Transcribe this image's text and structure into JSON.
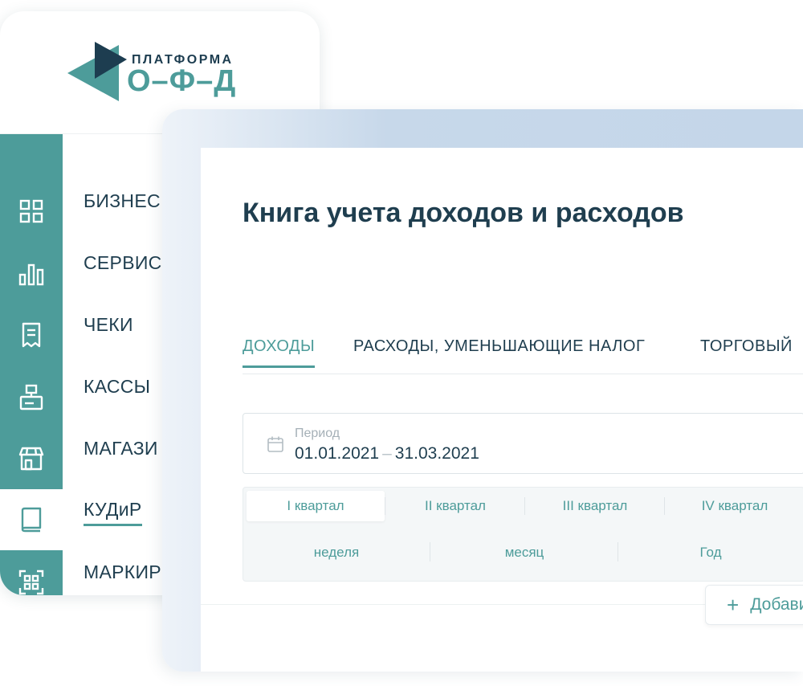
{
  "logo": {
    "line1": "ПЛАТФОРМА",
    "line2": "О–Ф–Д"
  },
  "nav": {
    "items": [
      {
        "label": "БИЗНЕС",
        "icon": "grid-icon"
      },
      {
        "label": "СЕРВИС",
        "icon": "bar-chart-icon"
      },
      {
        "label": "ЧЕКИ",
        "icon": "receipt-icon"
      },
      {
        "label": "КАССЫ",
        "icon": "cash-register-icon"
      },
      {
        "label": "МАГАЗИ",
        "icon": "store-icon"
      },
      {
        "label": "КУДиР",
        "icon": "book-icon"
      },
      {
        "label": "МАРКИР",
        "icon": "qr-code-icon"
      }
    ],
    "active_index": 5
  },
  "page": {
    "title": "Книга учета доходов и расходов"
  },
  "tabs": [
    {
      "label": "ДОХОДЫ"
    },
    {
      "label": "РАСХОДЫ, УМЕНЬШАЮЩИЕ НАЛОГ"
    },
    {
      "label": "ТОРГОВЫЙ"
    }
  ],
  "period": {
    "label": "Период",
    "start": "01.01.2021",
    "separator": "–",
    "end": "31.03.2021"
  },
  "quarters": [
    "I квартал",
    "II квартал",
    "III квартал",
    "IV квартал"
  ],
  "granularity": [
    "неделя",
    "месяц",
    "Год"
  ],
  "add_button": {
    "icon": "+",
    "label": "Добавить"
  },
  "colors": {
    "accent": "#4d9c9a",
    "text": "#1f3e4f",
    "card_frame": "#c4d6e9"
  }
}
